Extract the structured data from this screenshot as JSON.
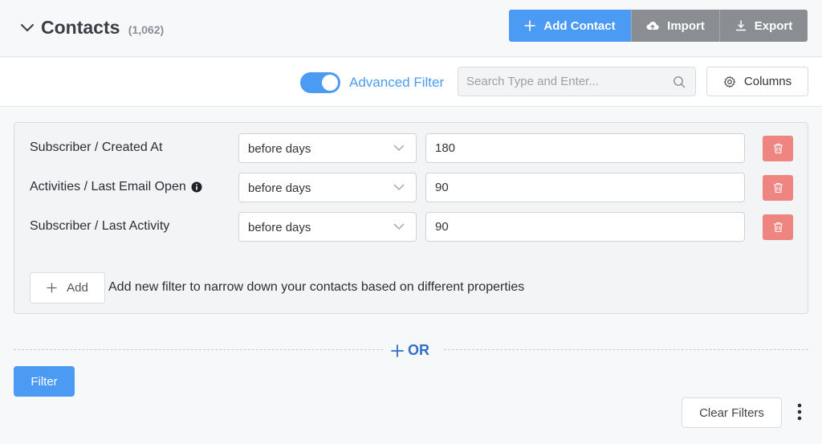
{
  "header": {
    "title": "Contacts",
    "count": "(1,062)",
    "add_contact_label": "Add Contact",
    "import_label": "Import",
    "export_label": "Export"
  },
  "toolbar": {
    "advanced_filter_label": "Advanced Filter",
    "advanced_filter_on": true,
    "search_placeholder": "Search Type and Enter...",
    "columns_label": "Columns"
  },
  "filters": [
    {
      "property": "Subscriber / Created At",
      "operator": "before days",
      "value": "180",
      "has_info": false
    },
    {
      "property": "Activities / Last Email Open",
      "operator": "before days",
      "value": "90",
      "has_info": true
    },
    {
      "property": "Subscriber / Last Activity",
      "operator": "before days",
      "value": "90",
      "has_info": false
    }
  ],
  "add_filter": {
    "label": "Add",
    "help_text": "Add new filter to narrow down your contacts based on different properties"
  },
  "or_label": "OR",
  "filter_button_label": "Filter",
  "clear_filters_label": "Clear Filters",
  "colors": {
    "primary": "#4b9bf5",
    "or_blue": "#2f6fc7",
    "danger": "#ee8580",
    "muted_button": "#8a8e93"
  },
  "icons": [
    "chevron-down-icon",
    "plus-icon",
    "cloud-upload-icon",
    "download-icon",
    "search-icon",
    "gear-icon",
    "info-icon",
    "trash-icon",
    "more-vertical-icon"
  ]
}
